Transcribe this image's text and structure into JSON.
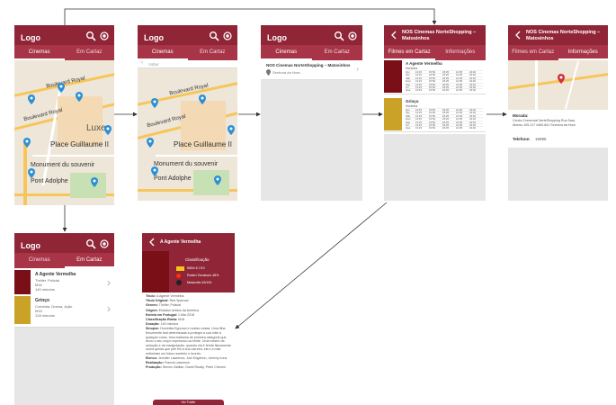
{
  "app": {
    "logo": "Logo",
    "accent": "#8f2536",
    "tab_bg": "#a73547"
  },
  "tabs": {
    "cinemas": "Cinemas",
    "em_cartaz": "Em Cartaz",
    "filmes_em_cartaz": "Filmes em Cartaz",
    "informacoes": "Informações"
  },
  "map": {
    "labels": [
      "Boulevard Royal",
      "Boulevard Royal",
      "Luxer",
      "Place Guillaume II",
      "Monument du souvenir",
      "Pont Adolphe",
      "Rue Notre Dame",
      "Rue du Fossé",
      "Boulevard Roosevelt",
      "Bd du Prince Henri"
    ],
    "back_label": "Voltar"
  },
  "cinema_list": {
    "name": "NOS Cinemas NorteShopping – Matosinhos",
    "address": "Senhora da Hora"
  },
  "cinema": {
    "title": "NOS Cinemas NorteShopping – Matosinhos"
  },
  "movies": [
    {
      "title": "A Agente Vermelha",
      "genre": "Thriller, Policial",
      "age": "M16",
      "duration": "140 minutos",
      "poster": "#7a0f18"
    },
    {
      "title": "Grinço",
      "genre": "Comédia, Drama, Ação",
      "age": "M16",
      "duration": "128 minutos",
      "poster": "#c9a227"
    }
  ],
  "schedule": {
    "header": "Horários",
    "days": [
      "Qui",
      "Sex",
      "Sáb",
      "Dom",
      "Seg",
      "Ter",
      "Qua"
    ],
    "times": [
      "13:15",
      "15:50",
      "18:25",
      "21:05",
      "23:40"
    ]
  },
  "info": {
    "place_label": "Morada:",
    "address": "Centro Comercial NorteShopping Rua Sara Afonso 105-117 4460-841 Senhora da Hora",
    "phone_label": "Telefone:",
    "phone": "16996"
  },
  "detail": {
    "title": "A Agente Vermelha",
    "classification_label": "Classificação",
    "ratings": [
      "IMDb 6.7/10",
      "Rotten Tomatoes 48%",
      "Metacritic 53/100"
    ],
    "fields": [
      {
        "label": "Título:",
        "value": "A Agente Vermelha"
      },
      {
        "label": "Título Original:",
        "value": "Red Sparrow"
      },
      {
        "label": "Género:",
        "value": "Thriller, Policial"
      },
      {
        "label": "Origem:",
        "value": "Estados Unidos da América"
      },
      {
        "label": "Estreia em Portugal:",
        "value": "1 Mar 2018"
      },
      {
        "label": "Classificação Etária:",
        "value": "M16"
      },
      {
        "label": "Duração:",
        "value": "140 minutos"
      },
      {
        "label": "Sinopse:",
        "value": "Dominika Egorova é muitas coisas. Uma filha ferozmente leal determinada a proteger a sua mãe a qualquer custo. Uma bailarina de primeira categoria que levou o seu corpo expressivo ao limite. Uma mestre da sedução e da manipulação, quando ela é ferida fisicamente numa queda que põe fim à sua carreira, ela e a mãe enfrentam um futuro sombrio e incerto."
      },
      {
        "label": "Elenco:",
        "value": "Jennifer Lawrence, Joel Edgerton, Jeremy Irons"
      },
      {
        "label": "Realização:",
        "value": "Francis Lawrence"
      },
      {
        "label": "Produção:",
        "value": "Steven Zaillian, David Ready, Peter Chernin"
      }
    ],
    "button": "Ver Trailer"
  }
}
